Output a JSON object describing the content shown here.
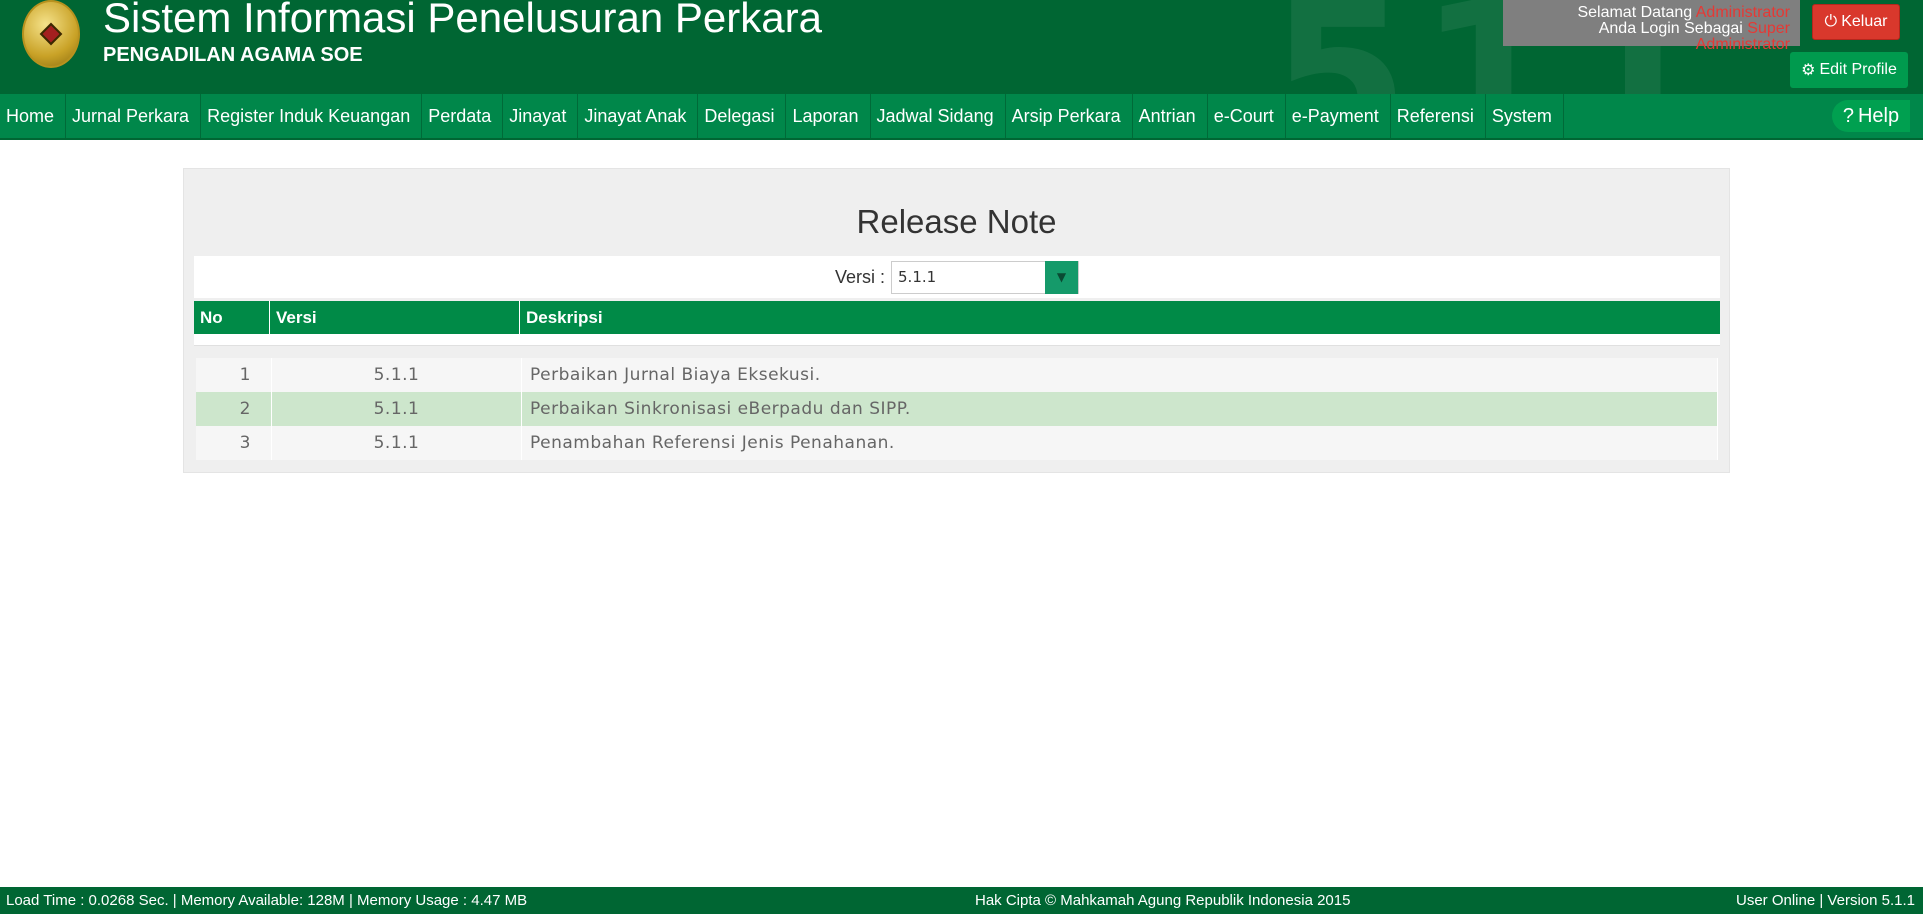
{
  "header": {
    "title": "Sistem Informasi Penelusuran Perkara",
    "subtitle": "PENGADILAN AGAMA SOE",
    "watermark": "511",
    "welcome_prefix": "Selamat Datang",
    "welcome_user": "Administrator",
    "login_prefix": "Anda Login Sebagai",
    "login_role": "Super Administrator",
    "logout_label": "Keluar",
    "edit_profile_label": "Edit Profile"
  },
  "nav": {
    "items": [
      "Home",
      "Jurnal Perkara",
      "Register Induk Keuangan",
      "Perdata",
      "Jinayat",
      "Jinayat Anak",
      "Delegasi",
      "Laporan",
      "Jadwal Sidang",
      "Arsip Perkara",
      "Antrian",
      "e-Court",
      "e-Payment",
      "Referensi",
      "System"
    ],
    "help_label": "Help"
  },
  "main": {
    "title": "Release Note",
    "version_label": "Versi :",
    "version_value": "5.1.1",
    "columns": [
      "No",
      "Versi",
      "Deskripsi"
    ],
    "rows": [
      {
        "no": "1",
        "versi": "5.1.1",
        "deskripsi": "Perbaikan Jurnal Biaya Eksekusi."
      },
      {
        "no": "2",
        "versi": "5.1.1",
        "deskripsi": "Perbaikan Sinkronisasi eBerpadu dan SIPP."
      },
      {
        "no": "3",
        "versi": "5.1.1",
        "deskripsi": "Penambahan Referensi Jenis Penahanan."
      }
    ]
  },
  "footer": {
    "left": "Load Time : 0.0268 Sec. | Memory Available: 128M | Memory Usage : 4.47 MB",
    "center": "Hak Cipta © Mahkamah Agung Republik Indonesia 2015",
    "right": "User Online | Version 5.1.1"
  },
  "colors": {
    "header_bg": "#006633",
    "nav_bg": "#00874a",
    "table_head_bg": "#008a47",
    "highlight_row": "#cde6cc",
    "logout_red": "#d9382c"
  }
}
